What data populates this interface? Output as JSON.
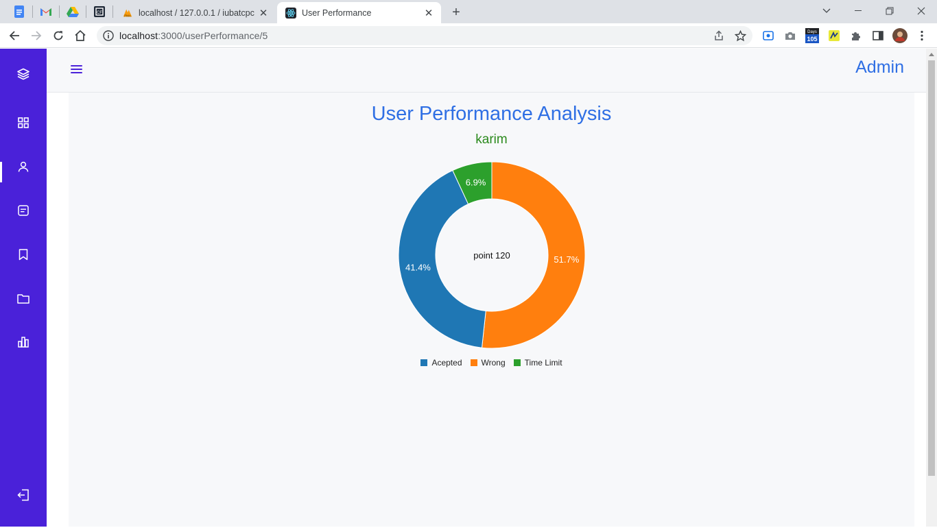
{
  "browser": {
    "tabs": [
      {
        "title": "localhost / 127.0.0.1 / iubatcpc / ",
        "active": false
      },
      {
        "title": "User Performance",
        "active": true
      }
    ],
    "url_host": "localhost",
    "url_path": ":3000/userPerformance/5",
    "extension_badge": "105",
    "extension_badge_top": "Days"
  },
  "app": {
    "admin_label": "Admin",
    "sidebar": {
      "items": [
        "layers-icon",
        "dashboard-icon",
        "user-icon",
        "message-icon",
        "bookmark-icon",
        "folder-icon",
        "bar-chart-icon",
        "logout-icon"
      ]
    },
    "accent": "#4a21d9"
  },
  "page": {
    "title": "User Performance Analysis",
    "user": "karim",
    "center_label": "point 120"
  },
  "chart_data": {
    "type": "pie",
    "variant": "donut",
    "categories": [
      "Acepted",
      "Wrong",
      "Time Limit"
    ],
    "values": [
      41.4,
      51.7,
      6.9
    ],
    "labels": [
      "41.4%",
      "51.7%",
      "6.9%"
    ],
    "colors": [
      "#1f77b4",
      "#ff7f0e",
      "#2ca02c"
    ],
    "legend_position": "bottom"
  }
}
